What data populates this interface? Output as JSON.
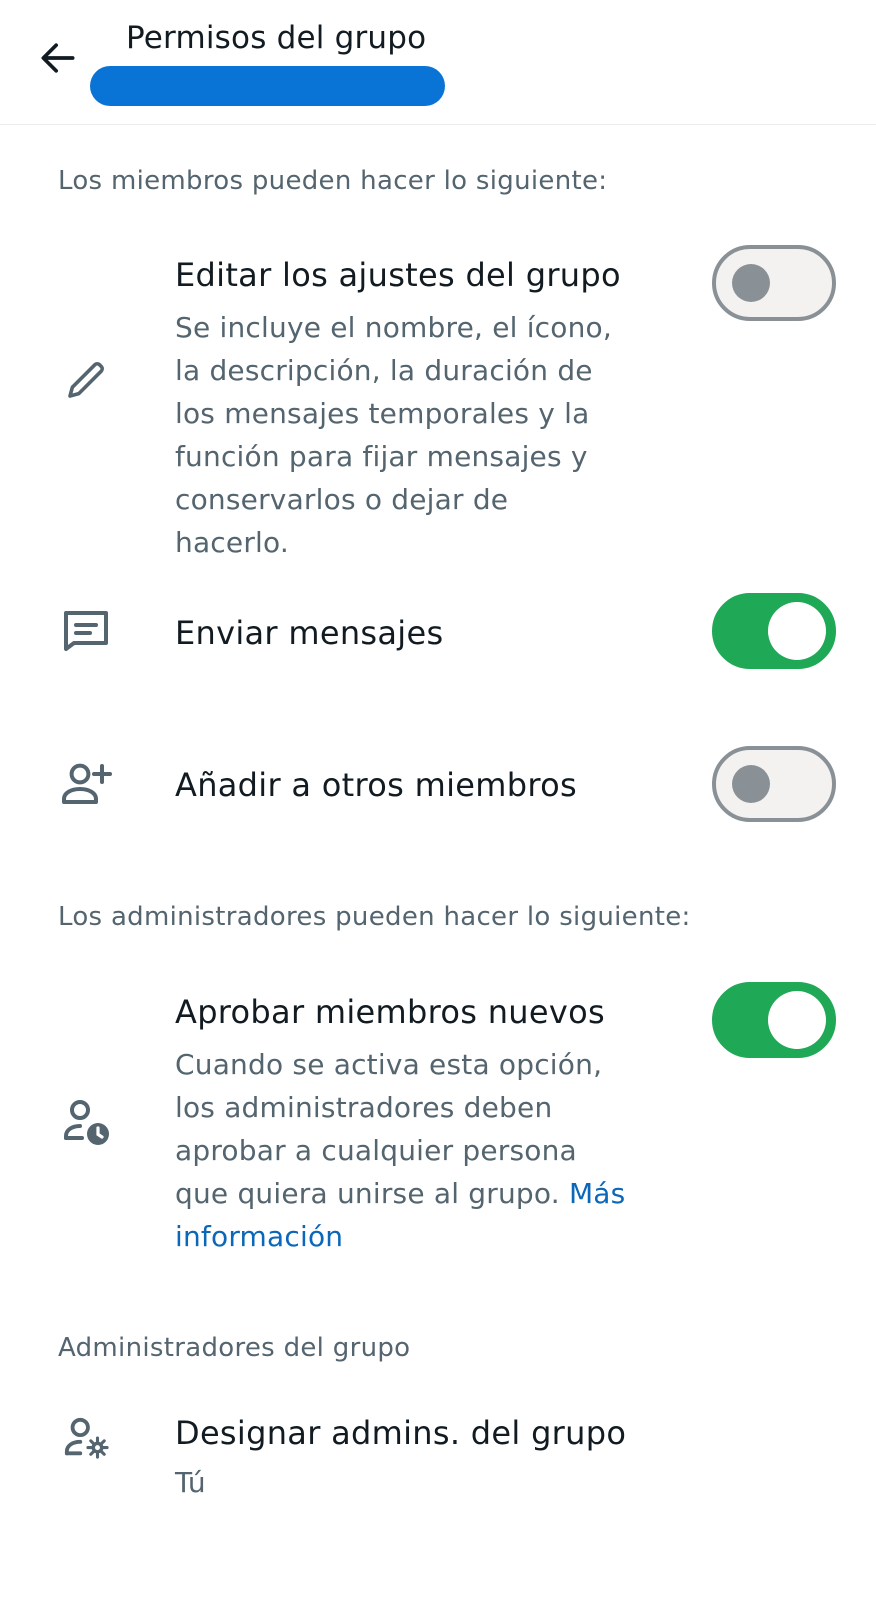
{
  "header": {
    "title": "Permisos del grupo",
    "redaction_color": "#0a74d6"
  },
  "members_section": {
    "label": "Los miembros pueden hacer lo siguiente:",
    "items": [
      {
        "icon": "pencil-icon",
        "title": "Editar los ajustes del grupo",
        "description": "Se incluye el nombre, el ícono, la descripción, la duración de los mensajes temporales y la función para fijar mensajes y conservarlos o dejar de hacerlo.",
        "enabled": false
      },
      {
        "icon": "message-icon",
        "title": "Enviar mensajes",
        "enabled": true
      },
      {
        "icon": "add-person-icon",
        "title": "Añadir a otros miembros",
        "enabled": false
      }
    ]
  },
  "admins_section": {
    "label": "Los administradores pueden hacer lo siguiente:",
    "items": [
      {
        "icon": "person-clock-icon",
        "title": "Aprobar miembros nuevos",
        "description": "Cuando se activa esta opción, los administradores deben aprobar a cualquier persona que quiera unirse al grupo.",
        "link": "Más información",
        "enabled": true
      }
    ]
  },
  "group_admins_section": {
    "label": "Administradores del grupo",
    "item": {
      "icon": "person-gear-icon",
      "title": "Designar admins. del grupo",
      "subtitle": "Tú"
    }
  },
  "colors": {
    "toggle_on": "#1fa855",
    "toggle_off_track": "#f4f2f0",
    "toggle_off_knob": "#8a9196",
    "link": "#0b67b8"
  }
}
